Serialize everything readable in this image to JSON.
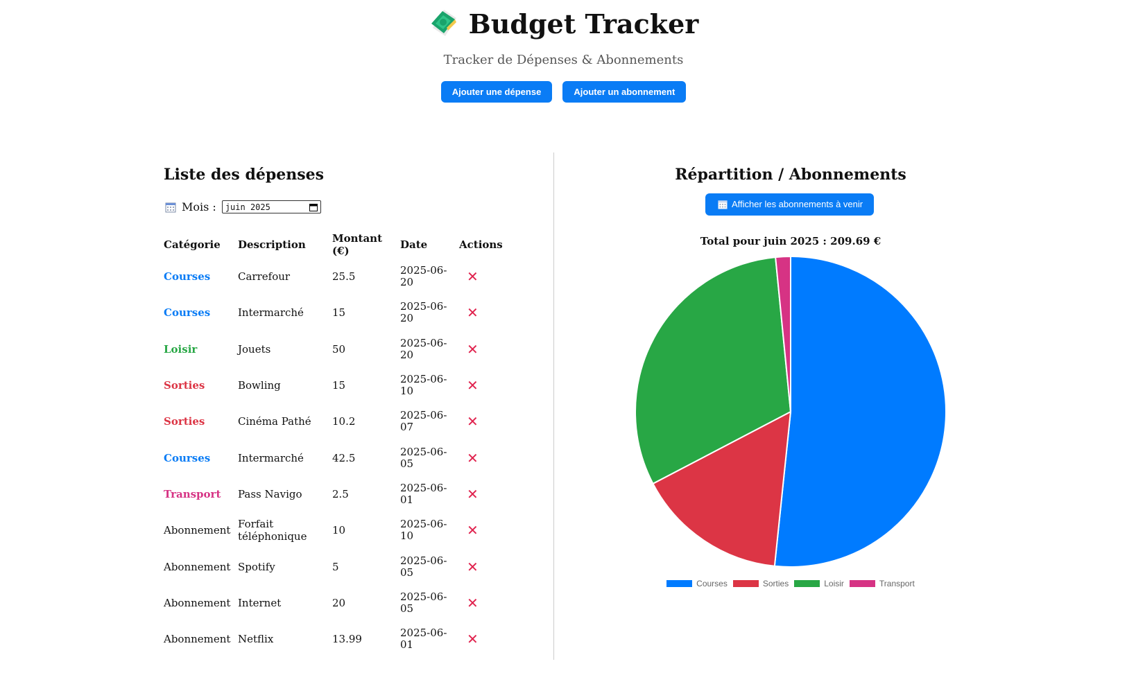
{
  "header": {
    "title": "Budget Tracker",
    "subtitle": "Tracker de Dépenses & Abonnements",
    "add_expense_label": "Ajouter une dépense",
    "add_subscription_label": "Ajouter un abonnement"
  },
  "expenses": {
    "title": "Liste des dépenses",
    "month_label": "Mois :",
    "month_value": "juin 2025",
    "columns": [
      "Catégorie",
      "Description",
      "Montant (€)",
      "Date",
      "Actions"
    ],
    "delete_glyph": "✕",
    "rows": [
      {
        "category": "Courses",
        "description": "Carrefour",
        "amount": "25.5",
        "date": "2025-06-20"
      },
      {
        "category": "Courses",
        "description": "Intermarché",
        "amount": "15",
        "date": "2025-06-20"
      },
      {
        "category": "Loisir",
        "description": "Jouets",
        "amount": "50",
        "date": "2025-06-20"
      },
      {
        "category": "Sorties",
        "description": "Bowling",
        "amount": "15",
        "date": "2025-06-10"
      },
      {
        "category": "Sorties",
        "description": "Cinéma Pathé",
        "amount": "10.2",
        "date": "2025-06-07"
      },
      {
        "category": "Courses",
        "description": "Intermarché",
        "amount": "42.5",
        "date": "2025-06-05"
      },
      {
        "category": "Transport",
        "description": "Pass Navigo",
        "amount": "2.5",
        "date": "2025-06-01"
      },
      {
        "category": "Abonnement",
        "description": "Forfait téléphonique",
        "amount": "10",
        "date": "2025-06-10"
      },
      {
        "category": "Abonnement",
        "description": "Spotify",
        "amount": "5",
        "date": "2025-06-05"
      },
      {
        "category": "Abonnement",
        "description": "Internet",
        "amount": "20",
        "date": "2025-06-05"
      },
      {
        "category": "Abonnement",
        "description": "Netflix",
        "amount": "13.99",
        "date": "2025-06-01"
      }
    ]
  },
  "category_colors": {
    "Courses": "#0a7cf5",
    "Sorties": "#dc3545",
    "Loisir": "#28a745",
    "Transport": "#d63384",
    "Abonnement": "#111111"
  },
  "chart_panel": {
    "title": "Répartition / Abonnements",
    "upcoming_button_label": "Afficher les abonnements à venir",
    "total_text": "Total pour juin 2025 : 209.69 €"
  },
  "chart_data": {
    "type": "pie",
    "categories": [
      "Courses",
      "Sorties",
      "Loisir",
      "Transport"
    ],
    "values": [
      83,
      25.2,
      50,
      2.5
    ],
    "colors": [
      "#007bff",
      "#dc3545",
      "#28a745",
      "#d63384"
    ],
    "legend_position": "bottom"
  }
}
